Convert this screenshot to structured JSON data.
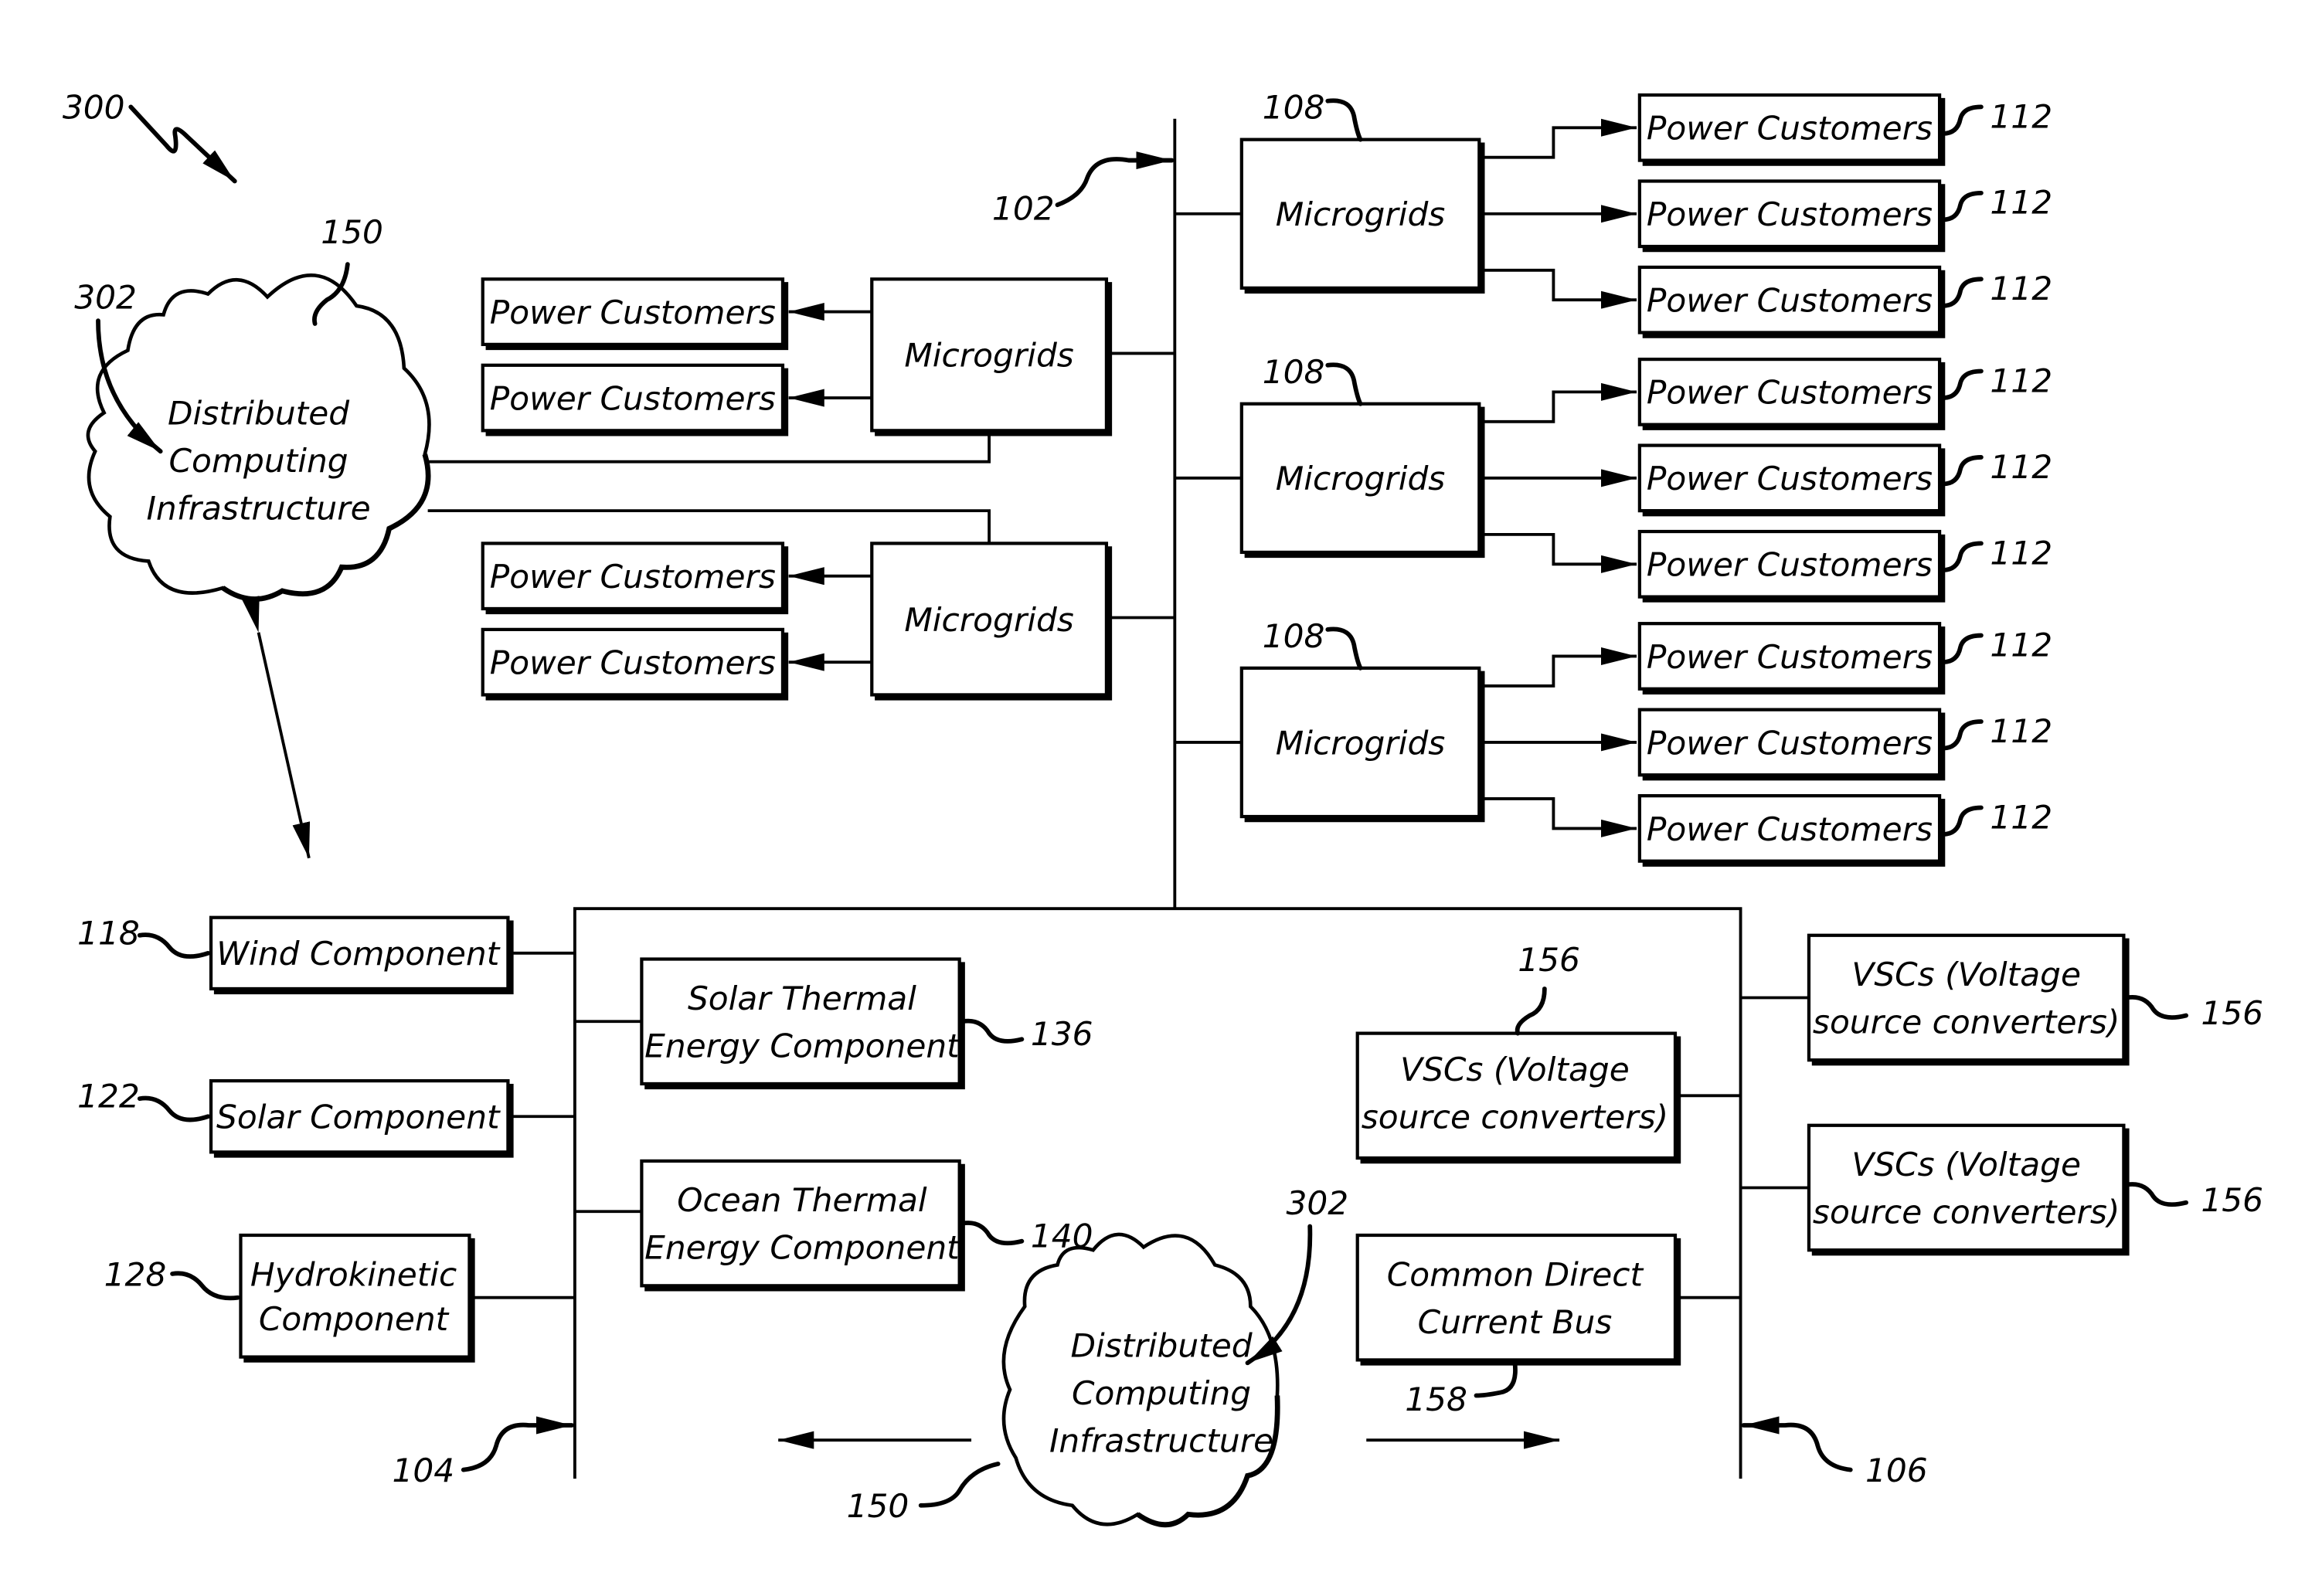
{
  "figure": {
    "number": "300",
    "colors": {
      "ink": "#000000",
      "paper": "#ffffff"
    }
  },
  "buses": [
    {
      "id": "102"
    },
    {
      "id": "104"
    },
    {
      "id": "106"
    }
  ],
  "clouds": [
    {
      "lines": [
        "Distributed",
        "Computing",
        "Infrastructure"
      ],
      "ref": "150",
      "ref2": "302"
    },
    {
      "lines": [
        "Distributed",
        "Computing",
        "Infrastructure"
      ],
      "ref": "150",
      "ref2": "302"
    }
  ],
  "left_microgrids": [
    {
      "label": "Microgrids",
      "customers": [
        "Power Customers",
        "Power Customers"
      ]
    },
    {
      "label": "Microgrids",
      "customers": [
        "Power Customers",
        "Power Customers"
      ]
    }
  ],
  "right_microgrids": [
    {
      "label": "Microgrids",
      "ref": "108",
      "customers": [
        {
          "label": "Power Customers",
          "ref": "112"
        },
        {
          "label": "Power Customers",
          "ref": "112"
        },
        {
          "label": "Power Customers",
          "ref": "112"
        }
      ]
    },
    {
      "label": "Microgrids",
      "ref": "108",
      "customers": [
        {
          "label": "Power Customers",
          "ref": "112"
        },
        {
          "label": "Power Customers",
          "ref": "112"
        },
        {
          "label": "Power Customers",
          "ref": "112"
        }
      ]
    },
    {
      "label": "Microgrids",
      "ref": "108",
      "customers": [
        {
          "label": "Power Customers",
          "ref": "112"
        },
        {
          "label": "Power Customers",
          "ref": "112"
        },
        {
          "label": "Power Customers",
          "ref": "112"
        }
      ]
    }
  ],
  "sources": [
    {
      "lines": [
        "Wind Component"
      ],
      "ref": "118"
    },
    {
      "lines": [
        "Solar Component"
      ],
      "ref": "122"
    },
    {
      "lines": [
        "Hydrokinetic",
        "Component"
      ],
      "ref": "128"
    },
    {
      "lines": [
        "Solar Thermal",
        "Energy Component"
      ],
      "ref": "136"
    },
    {
      "lines": [
        "Ocean Thermal",
        "Energy Component"
      ],
      "ref": "140"
    }
  ],
  "converters": [
    {
      "lines": [
        "VSCs (Voltage",
        "source converters)"
      ],
      "ref": "156"
    },
    {
      "lines": [
        "VSCs (Voltage",
        "source converters)"
      ],
      "ref": "156"
    },
    {
      "lines": [
        "VSCs (Voltage",
        "source converters)"
      ],
      "ref": "156"
    }
  ],
  "dc_bus": {
    "lines": [
      "Common Direct",
      "Current Bus"
    ],
    "ref": "158"
  }
}
